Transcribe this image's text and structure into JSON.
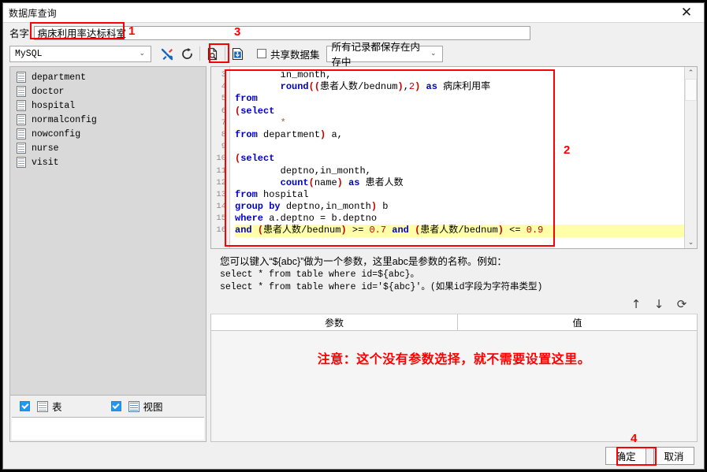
{
  "window": {
    "title": "数据库查询",
    "close_icon": "close-icon"
  },
  "name_row": {
    "label": "名字:",
    "value": "病床利用率达标科室"
  },
  "toolbar": {
    "db_type": "MySQL",
    "db_caret": "⌄",
    "icons": [
      {
        "name": "tools-wrench-icon",
        "glyph": "tools"
      },
      {
        "name": "refresh-icon",
        "glyph": "refresh"
      },
      {
        "name": "preview-query-icon",
        "glyph": "preview"
      },
      {
        "name": "save-dataset-icon",
        "glyph": "save"
      }
    ],
    "share_dataset_label": "共享数据集",
    "share_dataset_checked": false,
    "storage_mode": "所有记录都保存在内存中",
    "storage_caret": "⌄"
  },
  "tree": {
    "items": [
      {
        "label": "department",
        "icon": "table-icon"
      },
      {
        "label": "doctor",
        "icon": "table-icon"
      },
      {
        "label": "hospital",
        "icon": "table-icon"
      },
      {
        "label": "normalconfig",
        "icon": "table-icon"
      },
      {
        "label": "nowconfig",
        "icon": "table-icon"
      },
      {
        "label": "nurse",
        "icon": "table-icon"
      },
      {
        "label": "visit",
        "icon": "table-icon"
      }
    ],
    "footer": {
      "table_label": "表",
      "table_checked": true,
      "view_label": "视图",
      "view_checked": true
    }
  },
  "editor": {
    "first_line_number": 3,
    "line_numbers": [
      3,
      4,
      5,
      6,
      7,
      8,
      9,
      10,
      11,
      12,
      13,
      14,
      15,
      16
    ],
    "lines": [
      {
        "n": 3,
        "text": "        in_month,",
        "highlight": false
      },
      {
        "n": 4,
        "text": "        round((患者人数/bednum),2) as 病床利用率",
        "highlight": false
      },
      {
        "n": 5,
        "text": "from",
        "highlight": false
      },
      {
        "n": 6,
        "text": "(select",
        "highlight": false
      },
      {
        "n": 7,
        "text": "        *",
        "highlight": false
      },
      {
        "n": 8,
        "text": "from department) a,",
        "highlight": false
      },
      {
        "n": 9,
        "text": "",
        "highlight": false
      },
      {
        "n": 10,
        "text": "(select",
        "highlight": false
      },
      {
        "n": 11,
        "text": "        deptno,in_month,",
        "highlight": false
      },
      {
        "n": 12,
        "text": "        count(name) as 患者人数",
        "highlight": false
      },
      {
        "n": 13,
        "text": "from hospital",
        "highlight": false
      },
      {
        "n": 14,
        "text": "group by deptno,in_month) b",
        "highlight": false
      },
      {
        "n": 15,
        "text": "where a.deptno = b.deptno",
        "highlight": false
      },
      {
        "n": 16,
        "text": "and (患者人数/bednum) >= 0.7 and (患者人数/bednum) <= 0.9",
        "highlight": true
      }
    ],
    "scroll_up": "⌃",
    "scroll_down": "⌄"
  },
  "hint": {
    "line1": "您可以键入“${abc}”做为一个参数，这里abc是参数的名称。例如：",
    "line2": "select * from table where id=${abc}。",
    "line3": "select * from table where id='${abc}'。(如果id字段为字符串类型)"
  },
  "param_tools": {
    "move_up": "↑",
    "move_down": "↓",
    "refresh": "⟳"
  },
  "param_table": {
    "col_param": "参数",
    "col_value": "值",
    "warning": "注意：这个没有参数选择，就不需要设置这里。"
  },
  "footer": {
    "ok_label": "确定",
    "cancel_label": "取消"
  },
  "annotations": {
    "n1": "1",
    "n2": "2",
    "n3": "3",
    "n4": "4",
    "color": "#ff0000"
  }
}
